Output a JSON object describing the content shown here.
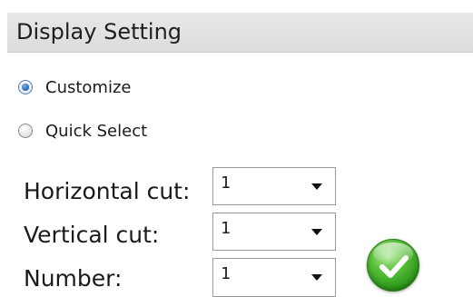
{
  "header": {
    "title": "Display Setting"
  },
  "mode": {
    "selected": "customize",
    "options": [
      {
        "key": "customize",
        "label": "Customize"
      },
      {
        "key": "quick_select",
        "label": "Quick Select"
      }
    ]
  },
  "fields": {
    "horizontal_cut": {
      "label": "Horizontal cut:",
      "value": "1"
    },
    "vertical_cut": {
      "label": "Vertical cut:",
      "value": "1"
    },
    "number": {
      "label": "Number:",
      "value": "1"
    }
  },
  "colors": {
    "header_background": "#dcdcdc",
    "confirm_button": "#3aa82a"
  },
  "icons": {
    "confirm": "checkmark-icon"
  }
}
